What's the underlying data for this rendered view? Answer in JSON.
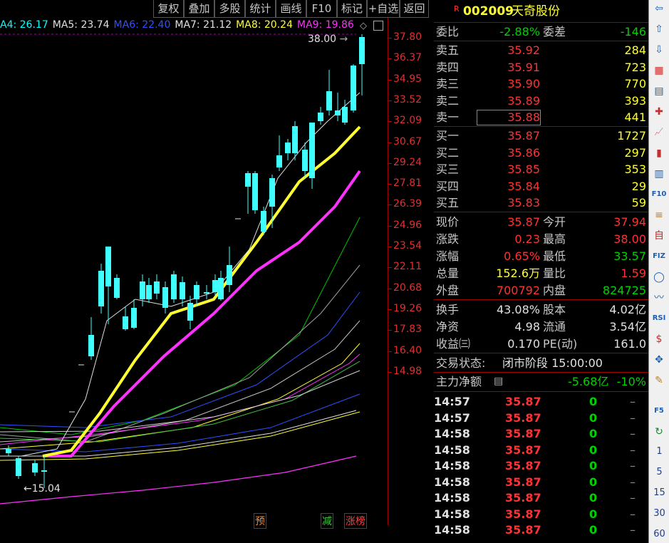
{
  "toolbar": {
    "items": [
      "复权",
      "叠加",
      "多股",
      "统计",
      "画线",
      "F10",
      "标记",
      "+自选",
      "返回"
    ]
  },
  "legend": [
    {
      "label": "A4: 26.17",
      "color": "#00ffff"
    },
    {
      "label": "MA5: 23.74",
      "color": "#e0e0e0"
    },
    {
      "label": "MA6: 22.40",
      "color": "#3050ff"
    },
    {
      "label": "MA7: 21.12",
      "color": "#e0e0e0"
    },
    {
      "label": "MA8: 20.24",
      "color": "#ffff30"
    },
    {
      "label": "MA9: 19.86",
      "color": "#ff30ff"
    }
  ],
  "price_axis": [
    "37.80",
    "36.37",
    "34.95",
    "33.52",
    "32.09",
    "30.67",
    "29.24",
    "27.81",
    "26.39",
    "24.96",
    "23.54",
    "22.11",
    "20.68",
    "19.26",
    "17.83",
    "16.40",
    "14.98"
  ],
  "annotations": {
    "high": "38.00",
    "low": "15.04"
  },
  "markers": [
    {
      "label": "预",
      "color": "#ff8c20"
    },
    {
      "label": "减",
      "color": "#40c040"
    },
    {
      "label": "涨榜",
      "color": "#ff4040"
    }
  ],
  "stock": {
    "flag": "R",
    "code": "002009",
    "name": "天奇股份"
  },
  "weibi": {
    "label": "委比",
    "value": "-2.88%",
    "label2": "委差",
    "value2": "-146"
  },
  "sell": [
    {
      "label": "卖五",
      "price": "35.92",
      "vol": "284"
    },
    {
      "label": "卖四",
      "price": "35.91",
      "vol": "723"
    },
    {
      "label": "卖三",
      "price": "35.90",
      "vol": "770"
    },
    {
      "label": "卖二",
      "price": "35.89",
      "vol": "393"
    },
    {
      "label": "卖一",
      "price": "35.88",
      "vol": "441"
    }
  ],
  "buy": [
    {
      "label": "买一",
      "price": "35.87",
      "vol": "1727"
    },
    {
      "label": "买二",
      "price": "35.86",
      "vol": "297"
    },
    {
      "label": "买三",
      "price": "35.85",
      "vol": "353"
    },
    {
      "label": "买四",
      "price": "35.84",
      "vol": "29"
    },
    {
      "label": "买五",
      "price": "35.83",
      "vol": "59"
    }
  ],
  "stats": [
    {
      "l1": "现价",
      "v1": "35.87",
      "c1": "red",
      "l2": "今开",
      "v2": "37.94",
      "c2": "red"
    },
    {
      "l1": "涨跌",
      "v1": "0.23",
      "c1": "red",
      "l2": "最高",
      "v2": "38.00",
      "c2": "red"
    },
    {
      "l1": "涨幅",
      "v1": "0.65%",
      "c1": "red",
      "l2": "最低",
      "v2": "33.57",
      "c2": "green"
    },
    {
      "l1": "总量",
      "v1": "152.6万",
      "c1": "yellow",
      "l2": "量比",
      "v2": "1.59",
      "c2": "red"
    },
    {
      "l1": "外盘",
      "v1": "700792",
      "c1": "red",
      "l2": "内盘",
      "v2": "824725",
      "c2": "green"
    }
  ],
  "stats2": [
    {
      "l1": "换手",
      "v1": "43.08%",
      "l2": "股本",
      "v2": "4.02亿"
    },
    {
      "l1": "净资",
      "v1": "4.98",
      "l2": "流通",
      "v2": "3.54亿"
    },
    {
      "l1": "收益㈢",
      "v1": "0.170",
      "l2": "PE(动)",
      "v2": "161.0"
    }
  ],
  "status": {
    "label": "交易状态:",
    "value": "闭市阶段 15:00:00"
  },
  "fund": {
    "label": "主力净额",
    "value": "-5.68亿",
    "pct": "-10%"
  },
  "trades": [
    {
      "time": "14:57",
      "price": "35.87",
      "vol": "0",
      "dir": "–"
    },
    {
      "time": "14:57",
      "price": "35.87",
      "vol": "0",
      "dir": "–"
    },
    {
      "time": "14:58",
      "price": "35.87",
      "vol": "0",
      "dir": "–"
    },
    {
      "time": "14:58",
      "price": "35.87",
      "vol": "0",
      "dir": "–"
    },
    {
      "time": "14:58",
      "price": "35.87",
      "vol": "0",
      "dir": "–"
    },
    {
      "time": "14:58",
      "price": "35.87",
      "vol": "0",
      "dir": "–"
    },
    {
      "time": "14:58",
      "price": "35.87",
      "vol": "0",
      "dir": "–"
    },
    {
      "time": "14:58",
      "price": "35.87",
      "vol": "0",
      "dir": "–"
    },
    {
      "time": "14:58",
      "price": "35.87",
      "vol": "0",
      "dir": "–"
    }
  ],
  "sidebar": {
    "icons": [
      "arrow-left-icon",
      "arrow-up-icon",
      "arrow-down-icon",
      "grid-icon",
      "table-icon",
      "cross-icon",
      "line-chart-icon",
      "candle-icon",
      "flow-icon",
      "f10-icon",
      "note-icon",
      "self-icon",
      "fiz-icon",
      "circle-icon",
      "wave-icon",
      "rsi-icon",
      "dollar-icon",
      "move-icon",
      "pen-icon",
      "f5-icon",
      "refresh-icon"
    ],
    "periods": [
      "1",
      "5",
      "15",
      "30",
      "60"
    ],
    "rsi": "RSI",
    "f10": "F10",
    "f5": "F5"
  }
}
